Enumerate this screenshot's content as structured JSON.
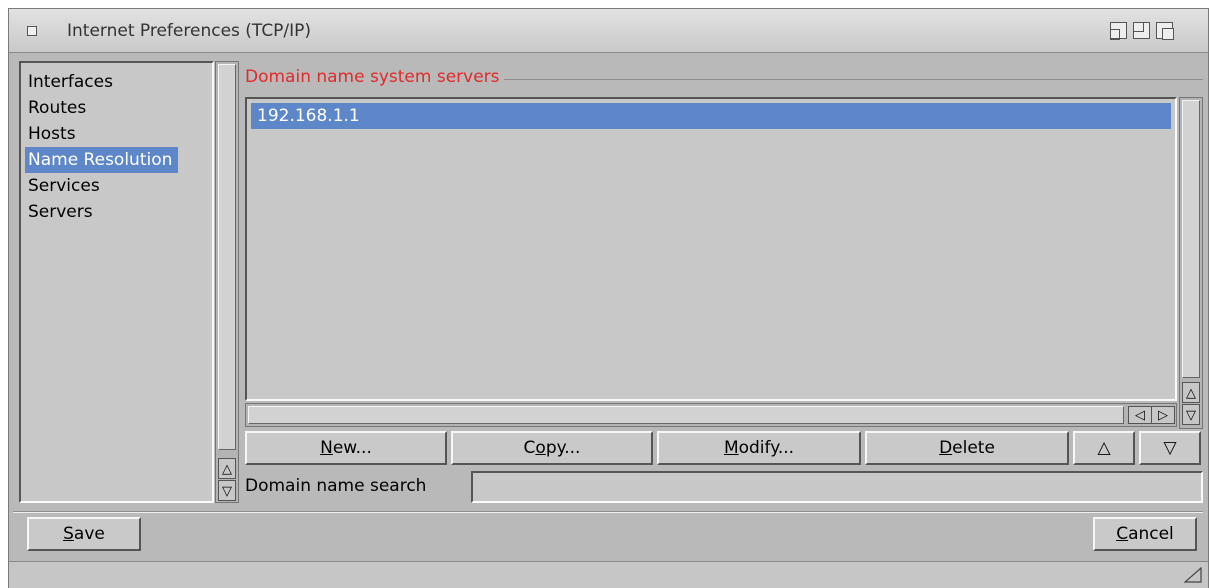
{
  "window": {
    "title": "Internet Preferences (TCP/IP)"
  },
  "sidebar": {
    "items": [
      {
        "label": "Interfaces"
      },
      {
        "label": "Routes"
      },
      {
        "label": "Hosts"
      },
      {
        "label": "Name Resolution",
        "selected": true
      },
      {
        "label": "Services"
      },
      {
        "label": "Servers"
      }
    ]
  },
  "dns": {
    "group_label": "Domain name system servers",
    "servers": [
      "192.168.1.1"
    ],
    "buttons": {
      "new_u": "N",
      "new_rest": "ew...",
      "copy_pre": "C",
      "copy_u": "o",
      "copy_rest": "py...",
      "modify_u": "M",
      "modify_rest": "odify...",
      "delete_u": "D",
      "delete_rest": "elete",
      "up": "△",
      "down": "▽"
    },
    "search_label": "Domain name search",
    "search_value": ""
  },
  "footer": {
    "save_u": "S",
    "save_rest": "ave",
    "cancel_u": "C",
    "cancel_rest": "ancel"
  },
  "icons": {
    "close": "close-box-icon",
    "zoom": "zoom-icon",
    "depth": "depth-icon",
    "resize": "resize-icon"
  },
  "colors": {
    "window_bg": "#b9b9b9",
    "selection": "#5d87c8",
    "group_label": "#e02b2b"
  }
}
